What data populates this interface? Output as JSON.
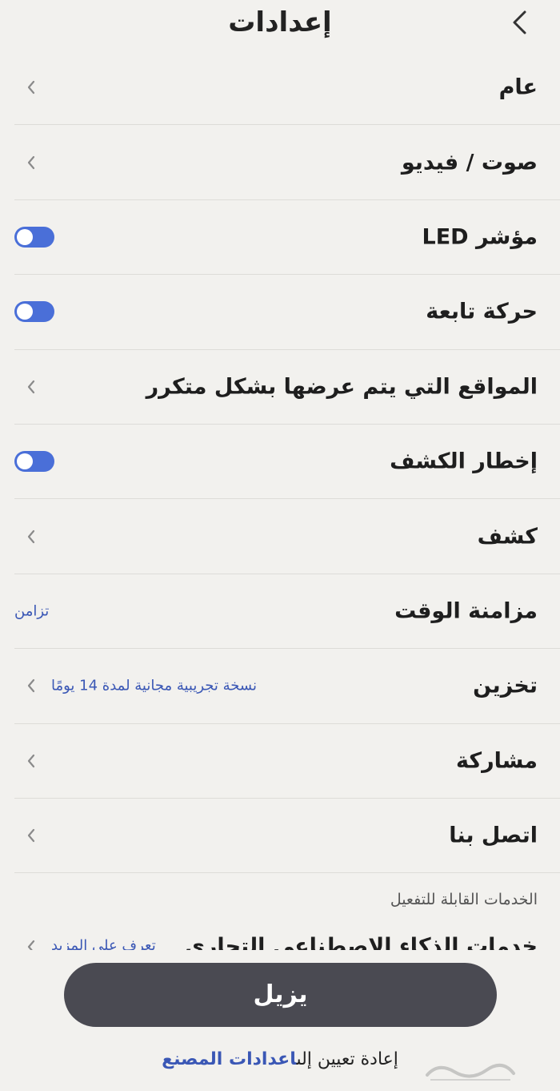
{
  "header": {
    "title": "إعدادات",
    "back_icon": "chevron-left-icon"
  },
  "items": [
    {
      "label": "عام",
      "type": "nav"
    },
    {
      "label": "صوت / فيديو",
      "type": "nav"
    },
    {
      "label": "مؤشر LED",
      "type": "toggle",
      "on": true
    },
    {
      "label": "حركة تابعة",
      "type": "toggle",
      "on": true
    },
    {
      "label": "المواقع التي يتم عرضها بشكل متكرر",
      "type": "nav"
    },
    {
      "label": "إخطار الكشف",
      "type": "toggle",
      "on": true
    },
    {
      "label": "كشف",
      "type": "nav"
    },
    {
      "label": "مزامنة الوقت",
      "type": "value",
      "value": "تزامن"
    },
    {
      "label": "تخزين",
      "type": "nav-value",
      "value": "نسخة تجريبية مجانية لمدة 14 يومًا"
    },
    {
      "label": "مشاركة",
      "type": "nav"
    },
    {
      "label": "اتصل بنا",
      "type": "nav"
    }
  ],
  "services": {
    "section_label": "الخدمات القابلة للتفعيل",
    "item_label": "خدمات الذكاء الاصطناعي التجاري",
    "item_value": "تعرف على المزيد"
  },
  "actions": {
    "remove_label": "يزيل",
    "reset_prefix": "إعادة تعيين إلى",
    "reset_link": "اعدادات المصنع"
  },
  "colors": {
    "accent": "#3a57b5",
    "toggle_on": "#4a6fd8",
    "button_bg": "#4a4a52",
    "background": "#f2f1ee"
  },
  "watermark": "حراج"
}
